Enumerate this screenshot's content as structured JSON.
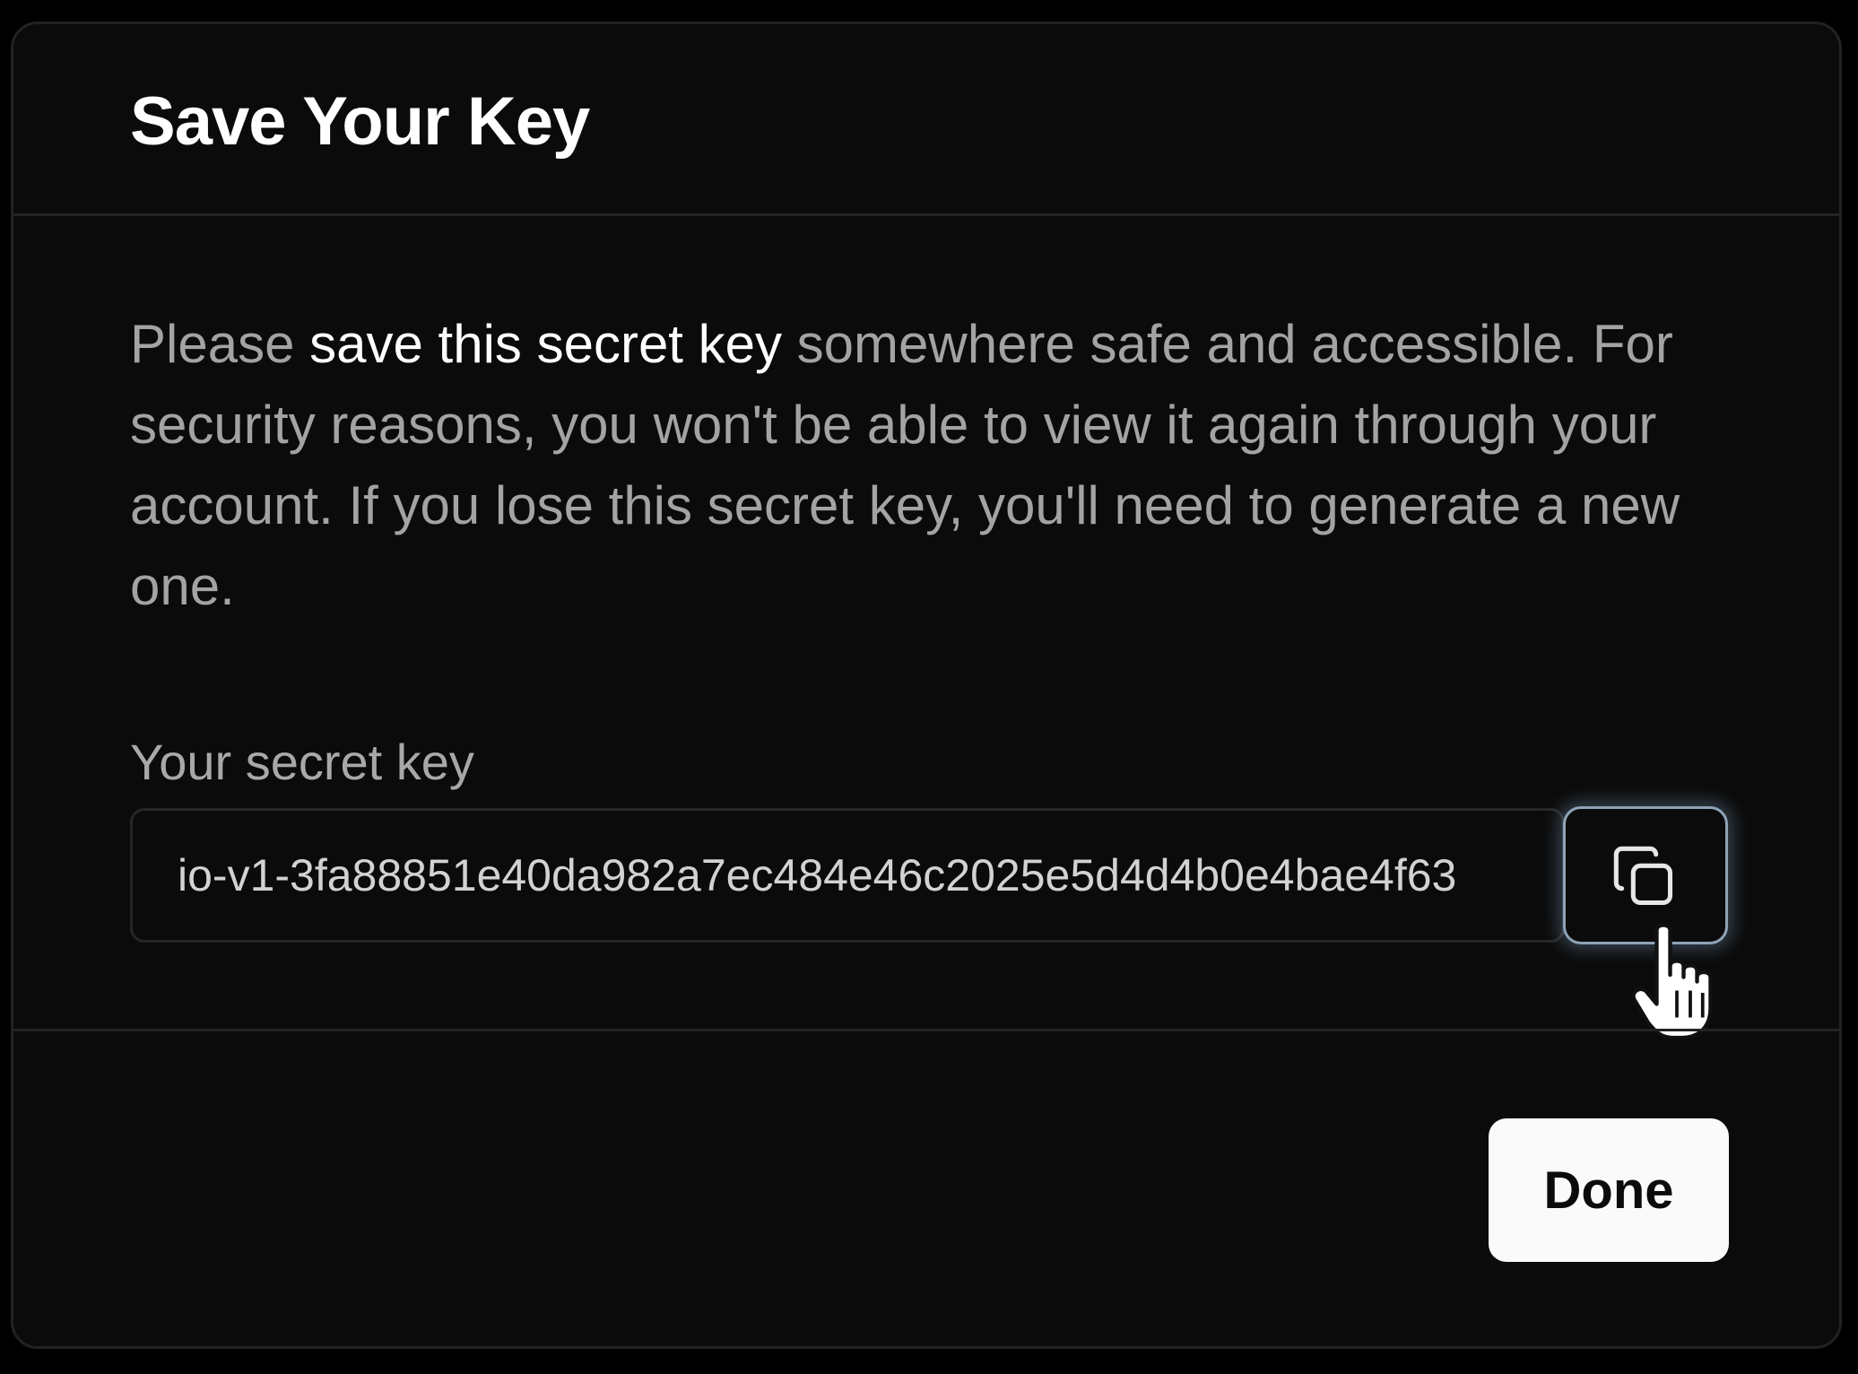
{
  "dialog": {
    "title": "Save Your Key",
    "message": {
      "prefix": "Please ",
      "emphasis": "save this secret key",
      "suffix": " somewhere safe and accessible. For security reasons, you won't be able to view it again through your account. If you lose this secret key, you'll need to generate a new one."
    },
    "field_label": "Your secret key",
    "secret_key": "io-v1-3fa88851e40da982a7ec484e46c2025e5d4d4b0e4bae4f63",
    "copy_icon": "copy-icon",
    "done_label": "Done"
  },
  "colors": {
    "background": "#0b0b0b",
    "title": "#ffffff",
    "muted_text": "#a3a3a3",
    "border": "#232323",
    "copy_focus_ring": "#8fa3b6",
    "done_button_bg": "#fafafa"
  }
}
